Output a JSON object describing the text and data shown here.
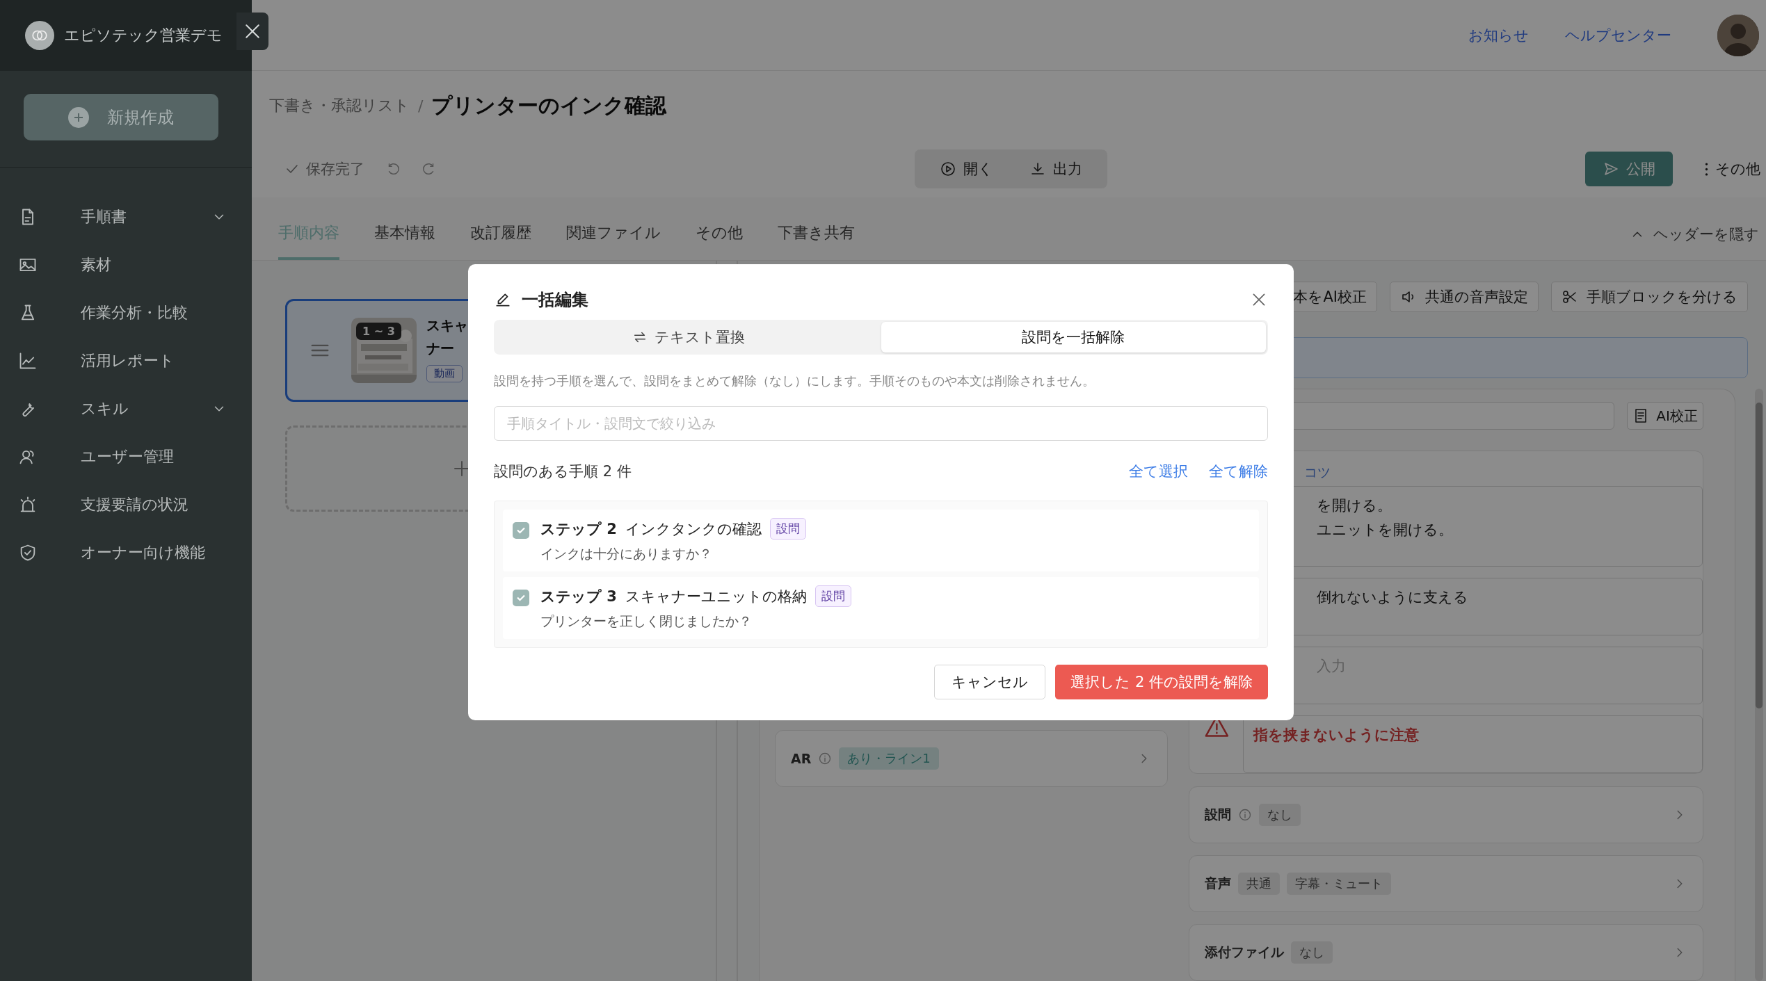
{
  "sidebar": {
    "workspace": "エピソテック営業デモ",
    "new_button": "新規作成",
    "items": [
      {
        "label": "手順書",
        "expandable": true
      },
      {
        "label": "素材",
        "expandable": false
      },
      {
        "label": "作業分析・比較",
        "expandable": false
      },
      {
        "label": "活用レポート",
        "expandable": false
      },
      {
        "label": "スキル",
        "expandable": true
      },
      {
        "label": "ユーザー管理",
        "expandable": false
      },
      {
        "label": "支援要請の状況",
        "expandable": false
      },
      {
        "label": "オーナー向け機能",
        "expandable": false
      }
    ]
  },
  "header": {
    "links": [
      "お知らせ",
      "ヘルプセンター"
    ]
  },
  "breadcrumb": {
    "parent": "下書き・承認リスト",
    "separator": "/",
    "title": "プリンターのインク確認"
  },
  "toolbar": {
    "save_status": "保存完了",
    "center_buttons": [
      "開く",
      "出力"
    ],
    "publish": "公開",
    "more": "その他"
  },
  "tabs": [
    {
      "label": "手順内容",
      "selected": true
    },
    {
      "label": "基本情報",
      "selected": false
    },
    {
      "label": "改訂履歴",
      "selected": false
    },
    {
      "label": "関連ファイル",
      "selected": false
    },
    {
      "label": "その他",
      "selected": false
    },
    {
      "label": "下書き共有",
      "selected": false
    }
  ],
  "hide_header": "ヘッダーを隠す",
  "step_card": {
    "badge": "1 ~ 3",
    "title_lines": [
      "スキャ",
      "ナー"
    ],
    "tag": "動画",
    "selected": true
  },
  "editor": {
    "tools": [
      "本をAI校正",
      "共通の音声設定",
      "手順ブロックを分ける"
    ],
    "ai_button": "AI校正",
    "tip_label": "コツ",
    "fields": [
      {
        "kind": "text",
        "lines": [
          "を開ける。",
          "ユニットを開ける。"
        ]
      },
      {
        "kind": "text",
        "lines": [
          "倒れないように支える"
        ]
      },
      {
        "kind": "placeholder",
        "lines": [
          "入力"
        ]
      },
      {
        "kind": "warning",
        "lines": [
          "指を挟まないように注意"
        ]
      }
    ],
    "ar": {
      "label": "AR",
      "info": true,
      "tags": [
        "あり・ライン1"
      ]
    },
    "rows": [
      {
        "label": "設問",
        "info": true,
        "tags": [
          "なし"
        ]
      },
      {
        "label": "音声",
        "info": false,
        "tags": [
          "共通",
          "字幕・ミュート"
        ]
      },
      {
        "label": "添付ファイル",
        "info": false,
        "tags": [
          "なし"
        ]
      }
    ]
  },
  "modal": {
    "title": "一括編集",
    "tabs": [
      {
        "label": "テキスト置換",
        "kind": "replace",
        "selected": false
      },
      {
        "label": "設問を一括解除",
        "kind": "plain",
        "selected": true
      }
    ],
    "description": "設問を持つ手順を選んで、設問をまとめて解除（なし）にします。手順そのものや本文は削除されません。",
    "search": {
      "placeholder": "手順タイトル・設問文で絞り込み"
    },
    "count": "設問のある手順 2 件",
    "links": [
      "全て選択",
      "全て解除"
    ],
    "items": [
      {
        "step": "ステップ 2",
        "title": "インクタンクの確認",
        "tag": "設問",
        "question": "インクは十分にありますか？",
        "checked": true
      },
      {
        "step": "ステップ 3",
        "title": "スキャナーユニットの格納",
        "tag": "設問",
        "question": "プリンターを正しく閉じましたか？",
        "checked": true
      }
    ],
    "cancel": "キャンセル",
    "confirm": "選択した 2 件の設問を解除"
  }
}
